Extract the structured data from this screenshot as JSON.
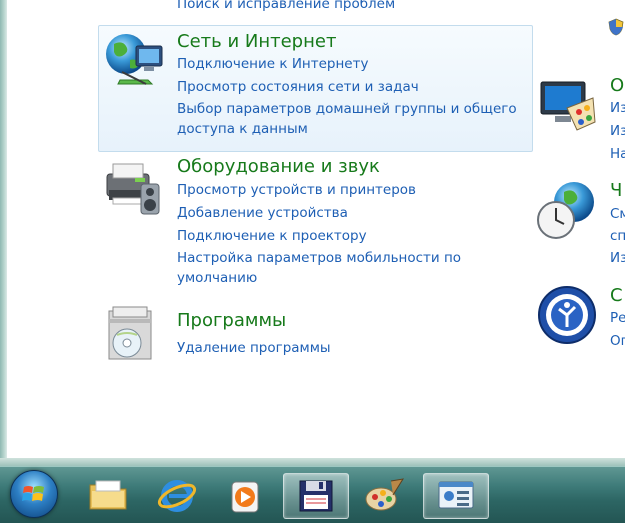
{
  "top_partial_link": "Поиск и исправление проблем",
  "categories": [
    {
      "title": "Сеть и Интернет",
      "icon": "network-globe-icon",
      "links": [
        "Подключение к Интернету",
        "Просмотр состояния сети и задач",
        "Выбор параметров домашней группы и общего доступа к данным"
      ]
    },
    {
      "title": "Оборудование и звук",
      "icon": "printer-hardware-icon",
      "links": [
        "Просмотр устройств и принтеров",
        "Добавление устройства",
        "Подключение к проектору",
        "Настройка параметров мобильности по умолчанию"
      ]
    },
    {
      "title": "Программы",
      "icon": "programs-disc-icon",
      "links": [
        "Удаление программы"
      ]
    }
  ],
  "right_column": {
    "appearance": {
      "title_fragment": "О",
      "links": [
        "Из",
        "Из",
        "На"
      ],
      "icon": "monitor-palette-icon"
    },
    "clock": {
      "title_fragment": "Ч",
      "links": [
        "См",
        "спо",
        "Из"
      ],
      "icon": "clock-globe-icon"
    },
    "ease": {
      "title_fragment": "С",
      "links": [
        "Ре",
        "Оп"
      ],
      "icon": "ease-of-access-icon"
    }
  },
  "taskbar": {
    "items": [
      {
        "name": "explorer",
        "icon": "folder-icon",
        "active": false
      },
      {
        "name": "ie",
        "icon": "internet-explorer-icon",
        "active": false
      },
      {
        "name": "media",
        "icon": "media-player-icon",
        "active": false
      },
      {
        "name": "save",
        "icon": "floppy-disk-icon",
        "active": true
      },
      {
        "name": "paint",
        "icon": "paint-palette-icon",
        "active": false
      },
      {
        "name": "control-panel",
        "icon": "control-panel-icon",
        "active": true
      }
    ]
  },
  "colors": {
    "link": "#1e5fb4",
    "category_title": "#177a1b",
    "taskbar": "#3d7a78"
  }
}
